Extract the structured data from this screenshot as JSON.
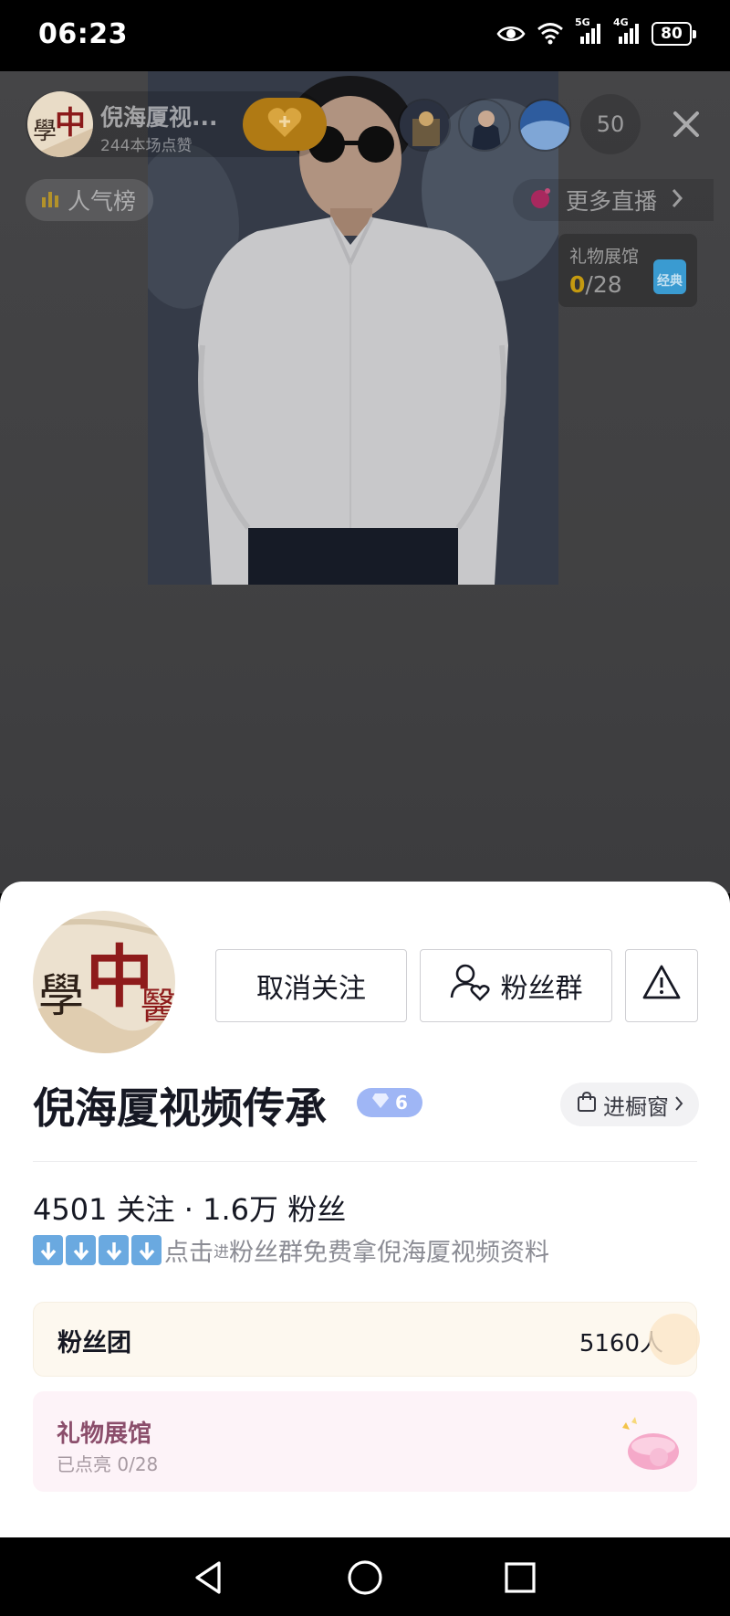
{
  "status_bar": {
    "time": "06:23",
    "network_5g": "5G",
    "network_4g": "4G",
    "battery": "80"
  },
  "live": {
    "anchor_name": "倪海厦视...",
    "anchor_likes": "244本场点赞",
    "viewer_count": "50",
    "rank_label": "人气榜",
    "more_live_label": "更多直播",
    "gift_hall_mini": {
      "title": "礼物展馆",
      "lit": "0",
      "total": "/28",
      "badge": "经典"
    }
  },
  "profile": {
    "unfollow_label": "取消关注",
    "fans_group_label": "粉丝群",
    "name": "倪海厦视频传承",
    "level": "6",
    "shop_label": "进橱窗",
    "stats": "4501 关注 · 1.6万 粉丝",
    "bio_prefix": "点击",
    "bio_small": "进",
    "bio_text": "粉丝群免费拿倪海厦视频资料",
    "fan_club": {
      "title": "粉丝团",
      "count": "5160人"
    },
    "gift_hall": {
      "title": "礼物展馆",
      "subtitle": "已点亮 0/28"
    }
  },
  "colors": {
    "badge_blue": "#9fb6f5",
    "fan_club_bg": "#fdf8ef",
    "gift_hall_bg": "#fdf3f8",
    "gift_hall_title": "#8b4e6b",
    "arrow_blue": "#6aa9e0"
  },
  "icons": [
    "eye-icon",
    "wifi-icon",
    "signal-icon",
    "battery-icon",
    "heart-plus-icon",
    "close-icon",
    "bar-chart-icon",
    "chevron-right-icon",
    "fans-group-icon",
    "warning-icon",
    "diamond-icon",
    "shopping-bag-icon",
    "down-arrow-icon",
    "back-nav-icon",
    "home-nav-icon",
    "recents-nav-icon"
  ]
}
